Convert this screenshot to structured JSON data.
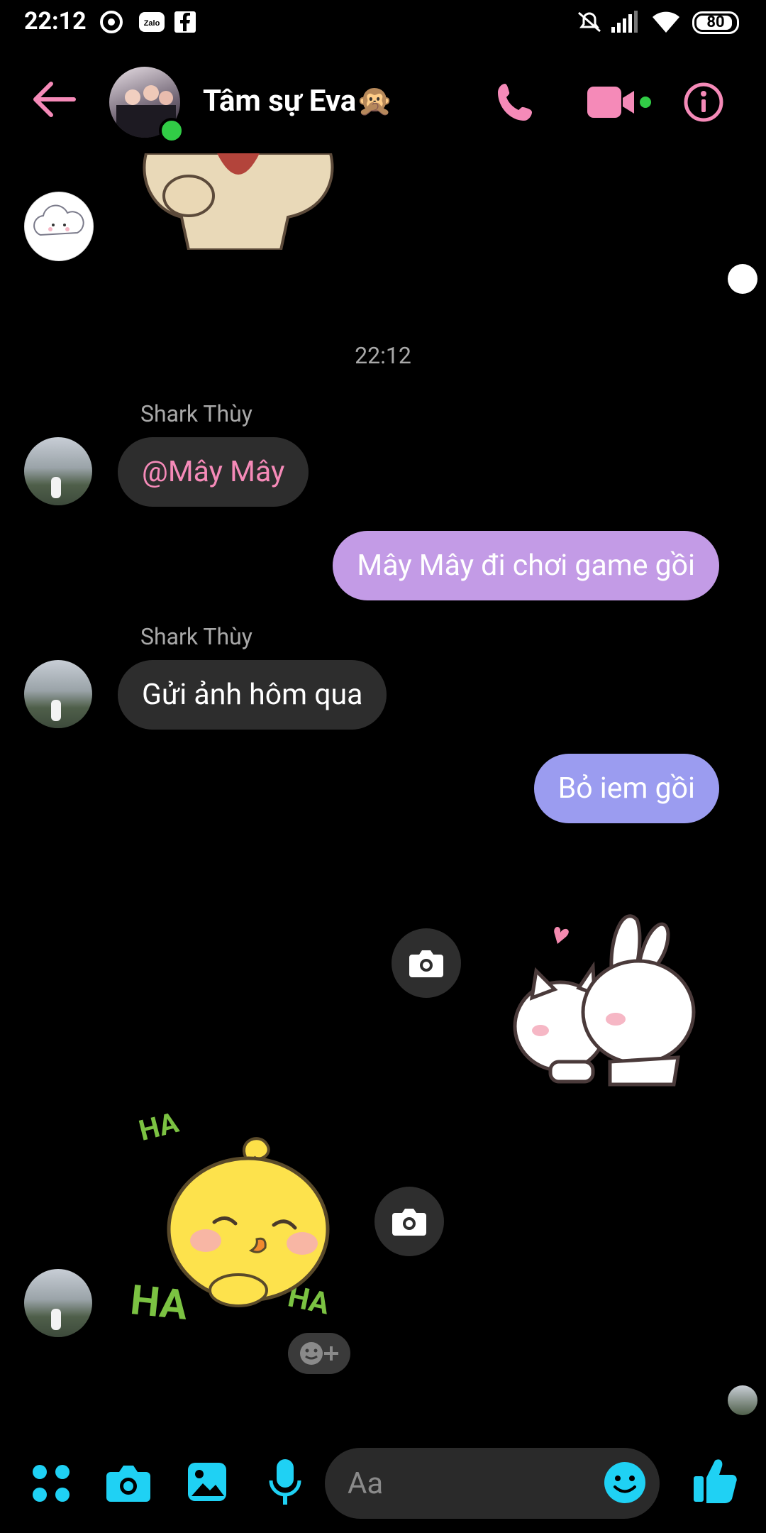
{
  "status_bar": {
    "time": "22:12",
    "battery": "80"
  },
  "header": {
    "title": "Tâm sự Eva",
    "title_emoji": "🙊",
    "icons": [
      "back-arrow-icon",
      "phone-icon",
      "video-camera-icon",
      "info-icon"
    ],
    "accent_color": "#f58ab8"
  },
  "conversation": {
    "time_separator": "22:12",
    "messages": [
      {
        "sender": "Shark Thùy",
        "text": "@Mây Mây",
        "direction": "incoming",
        "mention": true
      },
      {
        "text": "Mây Mây đi chơi game gồi",
        "direction": "outgoing",
        "color": "#c39be6"
      },
      {
        "sender": "Shark Thùy",
        "text": "Gửi ảnh hôm qua",
        "direction": "incoming"
      },
      {
        "text": "Bỏ iem gồi",
        "direction": "outgoing",
        "color": "#9b9cf0"
      }
    ],
    "stickers": [
      {
        "name": "cat-bunny-sticker",
        "direction": "outgoing"
      },
      {
        "name": "yellow-chick-laughing-sticker",
        "direction": "incoming",
        "text_top": "HA",
        "text_left": "HA",
        "text_right": "HA"
      }
    ]
  },
  "composer": {
    "placeholder": "Aa",
    "icons": [
      "apps-grid-icon",
      "camera-icon",
      "gallery-icon",
      "microphone-icon",
      "emoji-icon",
      "thumbs-up-icon"
    ],
    "icon_color": "#1fd1f4"
  }
}
